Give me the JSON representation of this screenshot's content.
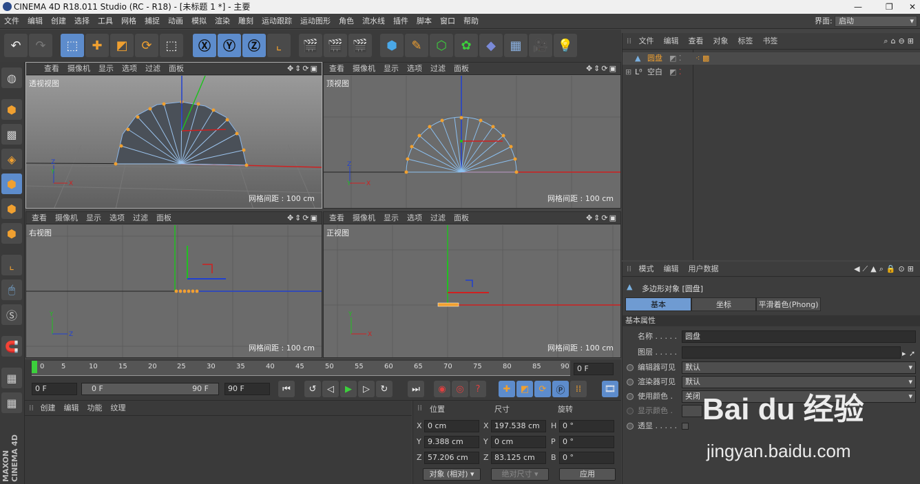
{
  "window": {
    "title": "CINEMA 4D R18.011 Studio (RC - R18) - [未标题 1 *] - 主要"
  },
  "menu": {
    "items": [
      "文件",
      "编辑",
      "创建",
      "选择",
      "工具",
      "网格",
      "捕捉",
      "动画",
      "模拟",
      "渲染",
      "雕刻",
      "运动跟踪",
      "运动图形",
      "角色",
      "流水线",
      "插件",
      "脚本",
      "窗口",
      "帮助"
    ],
    "layout_label": "界面:",
    "layout_value": "启动"
  },
  "viewport_menu": [
    "查看",
    "摄像机",
    "显示",
    "选项",
    "过滤",
    "面板"
  ],
  "viewports": [
    {
      "label": "透视视图",
      "grid": "网格间距 : 100 cm"
    },
    {
      "label": "顶视图",
      "grid": "网格间距 : 100 cm"
    },
    {
      "label": "右视图",
      "grid": "网格间距 : 100 cm"
    },
    {
      "label": "正视图",
      "grid": "网格间距 : 100 cm"
    }
  ],
  "timeline": {
    "ticks": [
      "0",
      "5",
      "10",
      "15",
      "20",
      "25",
      "30",
      "35",
      "40",
      "45",
      "50",
      "55",
      "60",
      "65",
      "70",
      "75",
      "80",
      "85",
      "90"
    ],
    "current_frame": "0 F",
    "start_field": "0 F",
    "range_start": "0 F",
    "range_end": "90 F",
    "end_field": "90 F"
  },
  "material_panel": {
    "menu": [
      "创建",
      "编辑",
      "功能",
      "纹理"
    ]
  },
  "coords": {
    "headers": {
      "position": "位置",
      "size": "尺寸",
      "rotation": "旋转"
    },
    "rows": [
      {
        "axis": "X",
        "pos": "0 cm",
        "size_axis": "X",
        "size": "197.538 cm",
        "rot_axis": "H",
        "rot": "0 °"
      },
      {
        "axis": "Y",
        "pos": "9.388 cm",
        "size_axis": "Y",
        "size": "0 cm",
        "rot_axis": "P",
        "rot": "0 °"
      },
      {
        "axis": "Z",
        "pos": "57.206 cm",
        "size_axis": "Z",
        "size": "83.125 cm",
        "rot_axis": "B",
        "rot": "0 °"
      }
    ],
    "mode_select": "对象 (相对)",
    "size_select": "绝对尺寸",
    "apply": "应用"
  },
  "object_manager": {
    "menu": [
      "文件",
      "编辑",
      "查看",
      "对象",
      "标签",
      "书签"
    ],
    "objects": [
      {
        "name": "圆盘",
        "icon": "polygon-object-icon"
      },
      {
        "name": "空白",
        "icon": "null-object-icon"
      }
    ]
  },
  "attribute_manager": {
    "menu": [
      "模式",
      "编辑",
      "用户数据"
    ],
    "object_title": "多边形对象 [圆盘]",
    "tabs": [
      "基本",
      "坐标",
      "平滑着色(Phong)"
    ],
    "section": "基本属性",
    "rows": [
      {
        "label": "名称 . . . . .",
        "value": "圆盘"
      },
      {
        "label": "图层 . . . . .",
        "value": ""
      },
      {
        "label": "编辑器可见",
        "value": "默认"
      },
      {
        "label": "渲染器可见",
        "value": "默认"
      },
      {
        "label": "使用颜色 .",
        "value": "关闭"
      },
      {
        "label": "显示颜色 .",
        "value": ""
      },
      {
        "label": "透显 . . . . .",
        "value": ""
      }
    ]
  },
  "watermark": {
    "brand": "Bai du 经验",
    "url": "jingyan.baidu.com"
  },
  "side_logo": "MAXON CINEMA 4D",
  "colors": {
    "accent": "#5d8ccc",
    "axis_x": "#d02020",
    "axis_y": "#20c020",
    "axis_z": "#2040d0",
    "point": "#f0a030"
  }
}
